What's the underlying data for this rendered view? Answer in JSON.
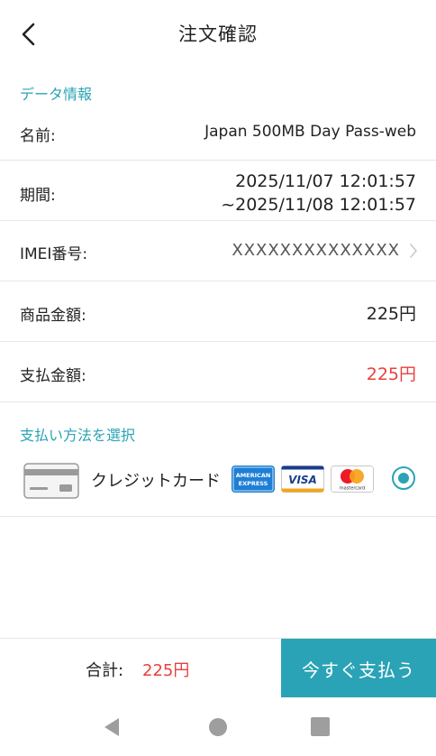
{
  "header": {
    "title": "注文確認",
    "back_icon": "chevron-left-icon"
  },
  "data_section": {
    "label": "データ情報",
    "name_label": "名前:",
    "name_value": "Japan 500MB Day Pass-web",
    "period_label": "期間:",
    "period_start": "2025/11/07 12:01:57",
    "period_end": "~2025/11/08 12:01:57",
    "imei_label": "IMEI番号:",
    "imei_value": "XXXXXXXXXXXXXX",
    "product_amount_label": "商品金額:",
    "product_amount_value": "225円",
    "payment_amount_label": "支払金額:",
    "payment_amount_value": "225円"
  },
  "payment_section": {
    "label": "支払い方法を選択",
    "method_label": "クレジットカード",
    "brands": [
      "amex-icon",
      "visa-icon",
      "mastercard-icon"
    ],
    "amex_text_top": "AMERICAN",
    "amex_text_bottom": "EXPRESS",
    "visa_text": "VISA",
    "mastercard_text": "mastercard",
    "selected": true
  },
  "bottom_bar": {
    "total_label": "合計:",
    "total_value": "225円",
    "pay_button_label": "今すぐ支払う"
  },
  "colors": {
    "accent": "#2aa3b6",
    "price_red": "#e8403e"
  }
}
